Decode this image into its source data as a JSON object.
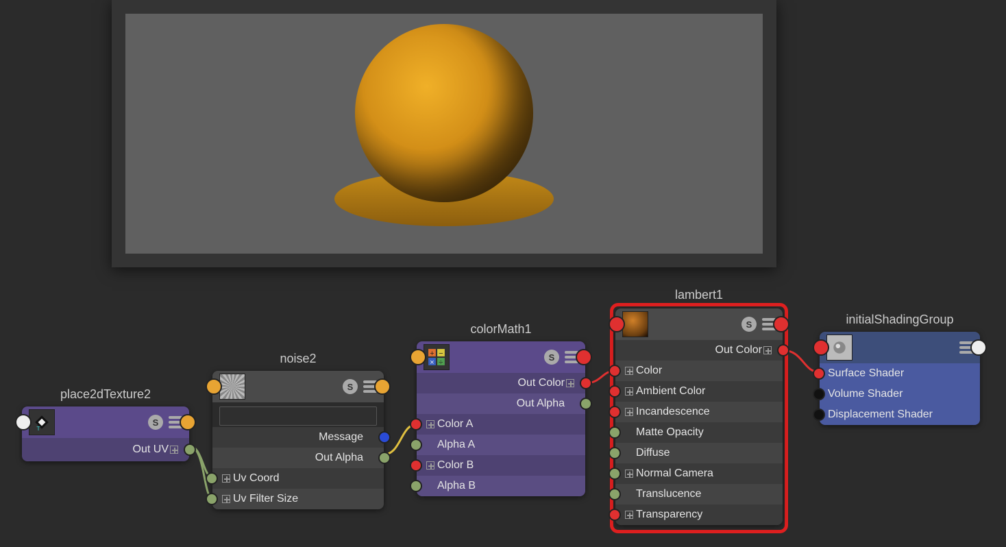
{
  "nodes": {
    "place2dTexture2": {
      "title": "place2dTexture2",
      "outputs": {
        "outUV": "Out UV"
      }
    },
    "noise2": {
      "title": "noise2",
      "filter_placeholder": "",
      "outputs": {
        "message": "Message",
        "outAlpha": "Out Alpha"
      },
      "inputs": {
        "uvCoord": "Uv Coord",
        "uvFilterSize": "Uv Filter Size"
      }
    },
    "colorMath1": {
      "title": "colorMath1",
      "outputs": {
        "outColor": "Out Color",
        "outAlpha": "Out Alpha"
      },
      "inputs": {
        "colorA": "Color A",
        "alphaA": "Alpha A",
        "colorB": "Color B",
        "alphaB": "Alpha B"
      }
    },
    "lambert1": {
      "title": "lambert1",
      "outputs": {
        "outColor": "Out Color"
      },
      "inputs": {
        "color": "Color",
        "ambientColor": "Ambient Color",
        "incandescence": "Incandescence",
        "matteOpacity": "Matte Opacity",
        "diffuse": "Diffuse",
        "normalCamera": "Normal Camera",
        "translucence": "Translucence",
        "transparency": "Transparency"
      }
    },
    "initialShadingGroup": {
      "title": "initialShadingGroup",
      "inputs": {
        "surfaceShader": "Surface Shader",
        "volumeShader": "Volume Shader",
        "displacementShader": "Displacement Shader"
      }
    }
  },
  "connections": [
    {
      "from": "place2dTexture2.outUV",
      "to": "noise2.uvCoord"
    },
    {
      "from": "place2dTexture2.outUV",
      "to": "noise2.uvFilterSize"
    },
    {
      "from": "noise2.outAlpha",
      "to": "colorMath1.colorA"
    },
    {
      "from": "colorMath1.outColor",
      "to": "lambert1.color"
    },
    {
      "from": "lambert1.outColor",
      "to": "initialShadingGroup.surfaceShader"
    }
  ],
  "selected_node": "lambert1"
}
